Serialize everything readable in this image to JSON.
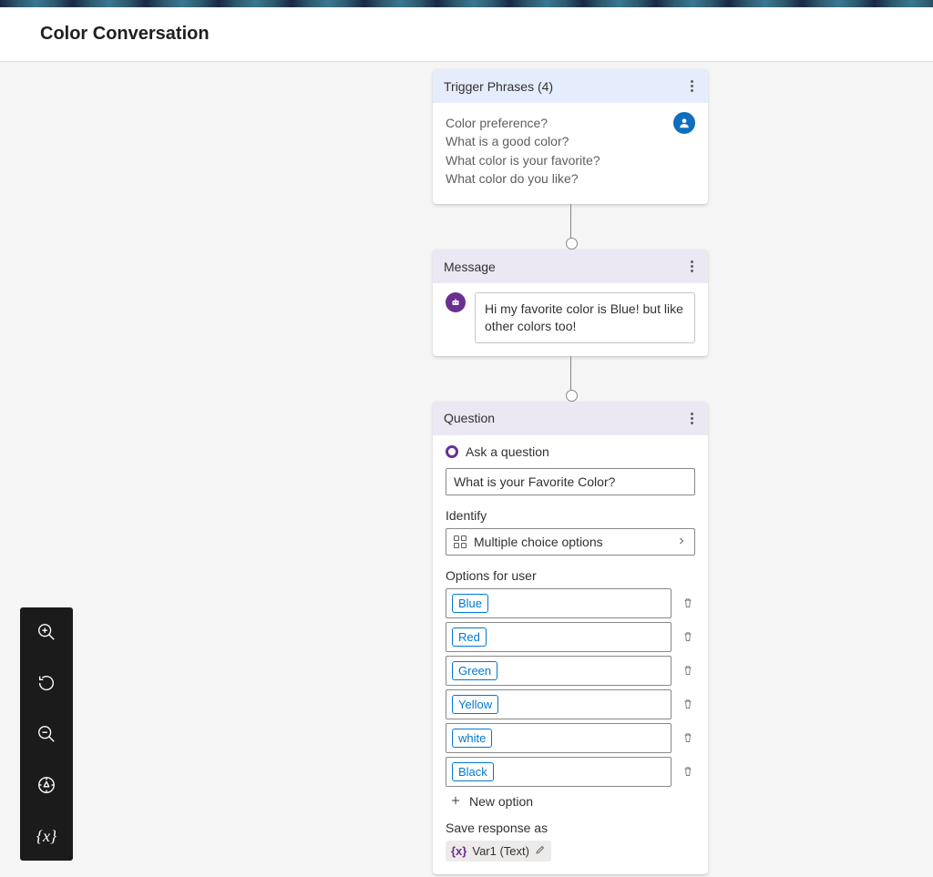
{
  "page_title": "Color Conversation",
  "trigger": {
    "header": "Trigger Phrases (4)",
    "phrases": [
      "Color preference?",
      "What is a good color?",
      "What color is your favorite?",
      "What color do you like?"
    ]
  },
  "message": {
    "header": "Message",
    "text": "Hi my favorite color is Blue! but like other colors too!"
  },
  "question": {
    "header": "Question",
    "ask_label": "Ask a question",
    "input_value": "What is your Favorite Color?",
    "identify_label": "Identify",
    "identify_value": "Multiple choice options",
    "options_label": "Options for user",
    "options": [
      "Blue",
      "Red",
      "Green",
      "Yellow",
      "white",
      "Black"
    ],
    "new_option_label": "New option",
    "save_response_label": "Save response as",
    "variable_name": "Var1 (Text)"
  },
  "toolbar": {
    "zoom_in": "zoom-in",
    "reset": "reset",
    "zoom_out": "zoom-out",
    "fit": "fit-view",
    "variables": "variables"
  }
}
